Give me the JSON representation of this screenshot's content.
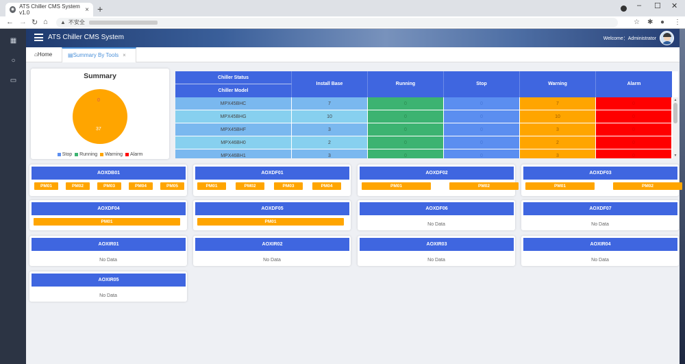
{
  "browser": {
    "tab_title": "ATS Chiller CMS System v1.0",
    "url_prefix": "不安全"
  },
  "app": {
    "title": "ATS Chiller CMS System",
    "welcome": "Welcome：Administrator"
  },
  "tabs": {
    "home": "Home",
    "summary": "Summary By Tools"
  },
  "summary": {
    "title": "Summary",
    "label_zero": "0",
    "label_total": "37",
    "legend": [
      {
        "label": "Stop",
        "color": "#5b8ef0"
      },
      {
        "label": "Running",
        "color": "#3cb371"
      },
      {
        "label": "Warning",
        "color": "#ffa500"
      },
      {
        "label": "Alarm",
        "color": "#ff0000"
      }
    ]
  },
  "chart_data": {
    "type": "pie",
    "title": "Summary",
    "categories": [
      "Stop",
      "Running",
      "Warning",
      "Alarm"
    ],
    "values": [
      0,
      0,
      37,
      0
    ],
    "colors": [
      "#5b8ef0",
      "#3cb371",
      "#ffa500",
      "#ff0000"
    ]
  },
  "table": {
    "headers": {
      "status": "Chiller Status",
      "model": "Chiller Model",
      "install": "Install Base",
      "running": "Running",
      "stop": "Stop",
      "warning": "Warning",
      "alarm": "Alarm"
    },
    "rows": [
      {
        "model": "MPX45BHC",
        "install": "7",
        "running": "0",
        "stop": "0",
        "warning": "7",
        "alarm": "0"
      },
      {
        "model": "MPX45BHG",
        "install": "10",
        "running": "0",
        "stop": "0",
        "warning": "10",
        "alarm": "0"
      },
      {
        "model": "MPX45BHF",
        "install": "3",
        "running": "0",
        "stop": "0",
        "warning": "3",
        "alarm": "0"
      },
      {
        "model": "MPX46BH0",
        "install": "2",
        "running": "0",
        "stop": "0",
        "warning": "2",
        "alarm": "0"
      },
      {
        "model": "MPX46BH1",
        "install": "3",
        "running": "0",
        "stop": "0",
        "warning": "3",
        "alarm": "0"
      }
    ]
  },
  "tools": [
    {
      "name": "AOXDB01",
      "pms": [
        "PM01",
        "PM02",
        "PM03",
        "PM04",
        "PM05"
      ]
    },
    {
      "name": "AOXDF01",
      "pms": [
        "PM01",
        "PM02",
        "PM03",
        "PM04"
      ]
    },
    {
      "name": "AOXDF02",
      "pms": [
        "PM01",
        "PM02"
      ]
    },
    {
      "name": "AOXDF03",
      "pms": [
        "PM01",
        "PM02"
      ]
    },
    {
      "name": "AOXDF04",
      "pms": [
        "PM01"
      ]
    },
    {
      "name": "AOXDF05",
      "pms": [
        "PM01"
      ]
    },
    {
      "name": "AOXDF06",
      "pms": []
    },
    {
      "name": "AOXDF07",
      "pms": []
    },
    {
      "name": "AOXIR01",
      "pms": []
    },
    {
      "name": "AOXIR02",
      "pms": []
    },
    {
      "name": "AOXIR03",
      "pms": []
    },
    {
      "name": "AOXIR04",
      "pms": []
    },
    {
      "name": "AOXIR05",
      "pms": []
    }
  ],
  "no_data_label": "No Data"
}
